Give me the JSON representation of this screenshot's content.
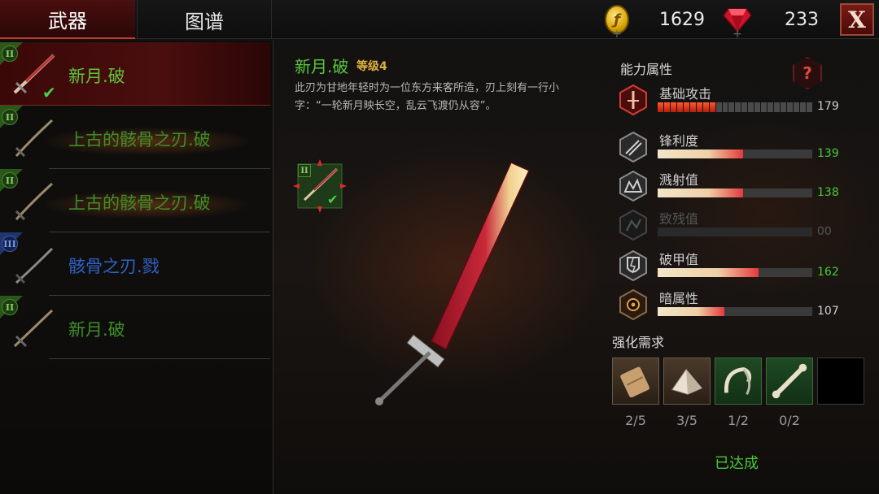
{
  "tabs": {
    "weapons": "武器",
    "codex": "图谱"
  },
  "currency": {
    "gold": "1629",
    "gems": "233",
    "gold_symbol": "ƒ",
    "plus": "+"
  },
  "close_label": "X",
  "weapon_list": [
    {
      "name": "新月.破",
      "rank": "II",
      "rarity": "green",
      "name_color": "#5cc53a",
      "selected": true,
      "equipped": true
    },
    {
      "name": "上古的骸骨之刃.破",
      "rank": "II",
      "rarity": "green",
      "name_color": "#3f8f28",
      "selected": false,
      "equipped": false
    },
    {
      "name": "上古的骸骨之刃.破",
      "rank": "II",
      "rarity": "green",
      "name_color": "#3f8f28",
      "selected": false,
      "equipped": false
    },
    {
      "name": "骸骨之刃.戮",
      "rank": "III",
      "rarity": "blue",
      "name_color": "#2f63c8",
      "selected": false,
      "equipped": false
    },
    {
      "name": "新月.破",
      "rank": "II",
      "rarity": "green",
      "name_color": "#3f8f28",
      "selected": false,
      "equipped": false
    }
  ],
  "detail": {
    "name": "新月.破",
    "level": "等级4",
    "description": "此刃为甘地年轻时为一位东方来客所造，刃上刻有一行小字：“一轮新月映长空，乱云飞渡仍从容”。",
    "rank": "II"
  },
  "attributes": {
    "title": "能力属性",
    "help": "?",
    "stats": [
      {
        "label": "基础攻击",
        "value": "179",
        "fill": 0.37,
        "value_color": "#cfcfcf",
        "style": "segmented"
      },
      {
        "label": "锋利度",
        "value": "139",
        "fill": 0.55,
        "value_color": "#4ac83a",
        "style": "bar"
      },
      {
        "label": "溅射值",
        "value": "138",
        "fill": 0.55,
        "value_color": "#4ac83a",
        "style": "bar"
      },
      {
        "label": "致残值",
        "value": "00",
        "fill": 0,
        "value_color": "#555555",
        "style": "bar",
        "dim": true
      },
      {
        "label": "破甲值",
        "value": "162",
        "fill": 0.65,
        "value_color": "#4ac83a",
        "style": "bar"
      },
      {
        "label": "暗属性",
        "value": "107",
        "fill": 0.43,
        "value_color": "#cfcfcf",
        "style": "bar"
      }
    ]
  },
  "upgrade": {
    "title": "强化需求",
    "materials": [
      {
        "icon": "wood-material-icon",
        "count": "2/5"
      },
      {
        "icon": "ore-material-icon",
        "count": "3/5"
      },
      {
        "icon": "claw-material-icon",
        "count": "1/2"
      },
      {
        "icon": "bone-material-icon",
        "count": "0/2"
      }
    ],
    "status": "已达成"
  }
}
